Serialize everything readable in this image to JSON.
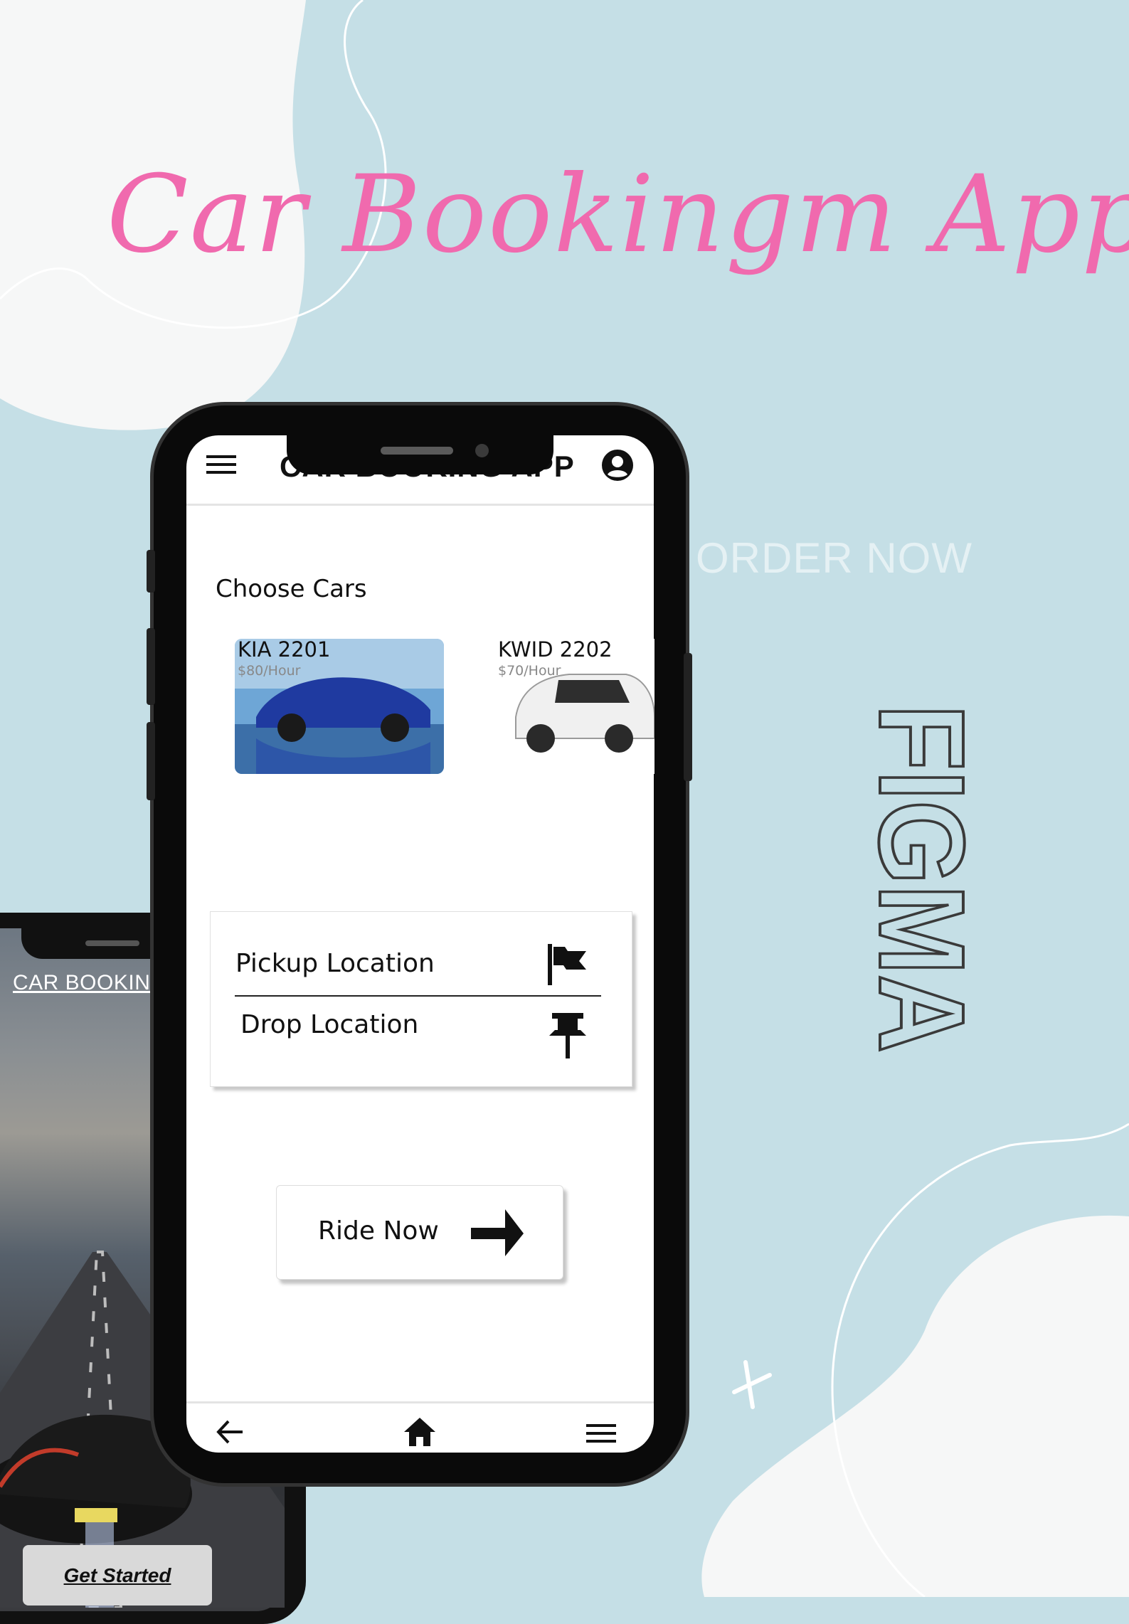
{
  "poster": {
    "title": "Car Bookingm App",
    "order_label": "ORDER NOW",
    "figma_label": "FIGMA",
    "colors": {
      "background": "#c5dfe6",
      "title_pink": "#f06aae"
    }
  },
  "back_phone": {
    "title": "CAR BOOKIN",
    "button_label": "Get Started"
  },
  "app": {
    "header": {
      "title": "CAR BOOKING APP",
      "menu_icon": "menu-icon",
      "user_icon": "user-circle-icon"
    },
    "section_title": "Choose Cars",
    "cars": [
      {
        "name": "KIA 2201",
        "price": "$80/Hour",
        "color": "#1f3aa0"
      },
      {
        "name": "KWID 2202",
        "price": "$70/Hour",
        "color": "#ffffff"
      }
    ],
    "locations": {
      "pickup_label": "Pickup Location",
      "pickup_icon": "flag-icon",
      "drop_label": "Drop Location",
      "drop_icon": "pin-icon"
    },
    "ride_button": {
      "label": "Ride Now",
      "icon": "arrow-right-icon"
    },
    "bottom_nav": {
      "items": [
        "back-arrow-icon",
        "home-icon",
        "menu-icon"
      ]
    }
  }
}
